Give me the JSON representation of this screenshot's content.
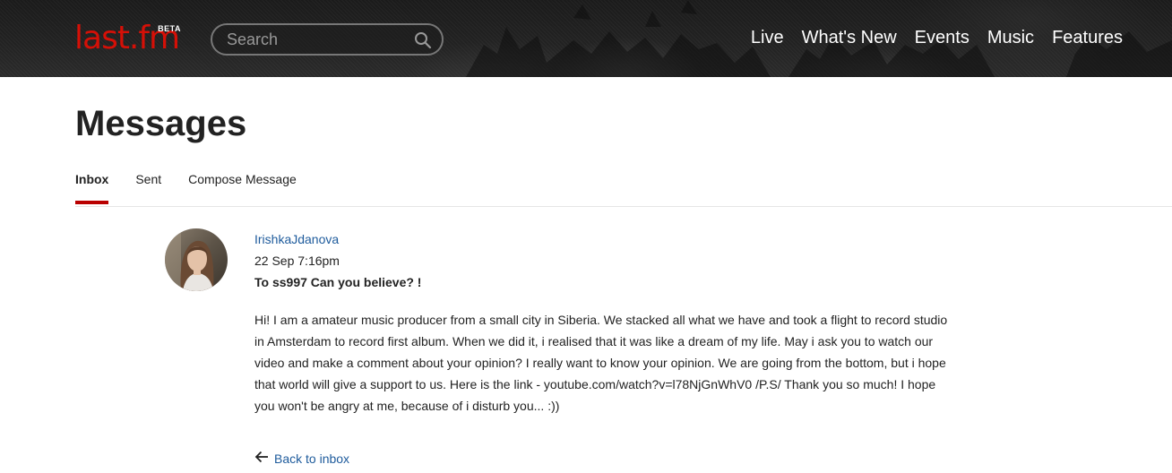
{
  "header": {
    "logo_text": "last.fm",
    "logo_badge": "BETA",
    "brand_color": "#d51007",
    "search_placeholder": "Search",
    "nav": [
      {
        "label": "Live"
      },
      {
        "label": "What's New"
      },
      {
        "label": "Events"
      },
      {
        "label": "Music"
      },
      {
        "label": "Features"
      }
    ]
  },
  "page": {
    "title": "Messages",
    "tabs": [
      {
        "label": "Inbox",
        "active": true
      },
      {
        "label": "Sent",
        "active": false
      },
      {
        "label": "Compose Message",
        "active": false
      }
    ],
    "accent_color": "#b90000",
    "link_color": "#1e5b9c"
  },
  "message": {
    "sender": "IrishkaJdanova",
    "date": "22 Sep 7:16pm",
    "subject": "To ss997 Can you believe? !",
    "body": "Hi! I am a amateur music producer from a small city in Siberia. We stacked all what we have and took a flight to record studio in Amsterdam to record first album. When we did it, i realised that it was like a dream of my life. May i ask you to watch our video and make a comment about your opinion? I really want to know your opinion. We are going from the bottom, but i hope that world will give a support to us. Here is the link - youtube.com/watch?v=l78NjGnWhV0 /P.S/ Thank you so much! I hope you won't be angry at me, because of i disturb you... :))"
  },
  "footer_link": {
    "label": "Back to inbox",
    "icon": "arrow-left-icon"
  }
}
